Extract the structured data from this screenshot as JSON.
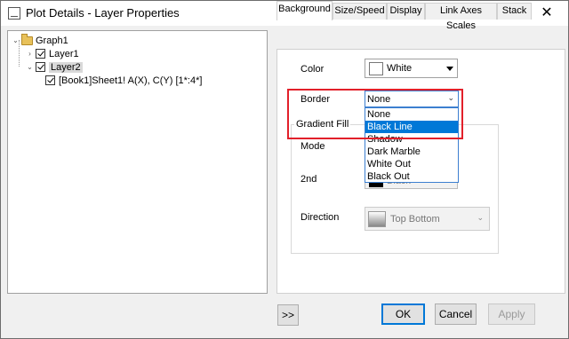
{
  "window": {
    "title": "Plot Details - Layer Properties",
    "help_label": "?",
    "close_label": "✕"
  },
  "tree": {
    "root": "Graph1",
    "layer1": "Layer1",
    "layer2": "Layer2",
    "plot": "[Book1]Sheet1! A(X), C(Y) [1*:4*]"
  },
  "tabs": [
    "Background",
    "Size/Speed",
    "Display",
    "Link Axes Scales",
    "Stack"
  ],
  "background": {
    "color_label": "Color",
    "color_value": "White",
    "border_label": "Border",
    "border_value": "None",
    "border_options": [
      "None",
      "Black Line",
      "Shadow",
      "Dark Marble",
      "White Out",
      "Black Out"
    ],
    "border_highlighted": "Black Line",
    "gradient_title": "Gradient Fill",
    "mode_label": "Mode",
    "second_label": "2nd",
    "second_value": "Black",
    "direction_label": "Direction",
    "direction_value": "Top Bottom"
  },
  "buttons": {
    "expand": ">>",
    "ok": "OK",
    "cancel": "Cancel",
    "apply": "Apply"
  },
  "colors": {
    "accent": "#0078d7",
    "highlight_box": "#e2202a"
  }
}
